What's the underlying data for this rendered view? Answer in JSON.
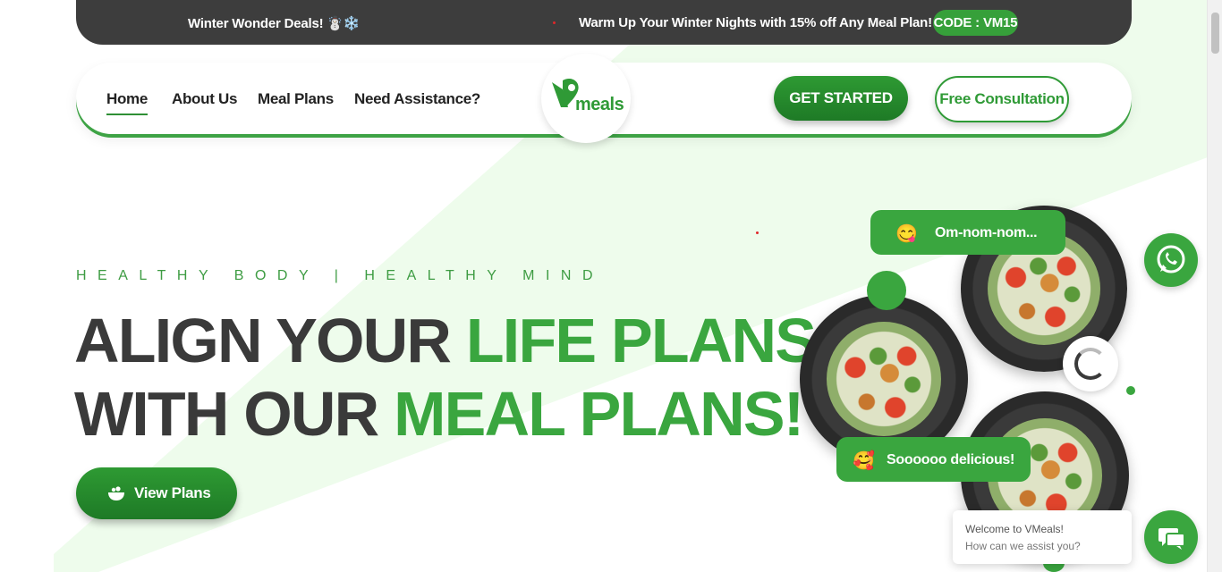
{
  "promo": {
    "left_text": "Winter Wonder Deals! ☃️❄️",
    "right_text": "Warm Up Your Winter Nights with 15% off Any Meal Plan!",
    "code": "CODE : VM15"
  },
  "nav": {
    "items": [
      {
        "label": "Home",
        "active": true
      },
      {
        "label": "About Us",
        "active": false
      },
      {
        "label": "Meal Plans",
        "active": false
      },
      {
        "label": "Need Assistance?",
        "active": false
      }
    ],
    "logo_word": "meals",
    "get_started": "GET STARTED",
    "free_consultation": "Free Consultation"
  },
  "hero": {
    "tagline": "HEALTHY BODY | HEALTHY MIND",
    "line1_dark": "ALIGN YOUR ",
    "line1_green": "LIFE PLANS",
    "line2_dark": "WITH OUR ",
    "line2_green": "MEAL PLANS!",
    "view_plans": "View Plans"
  },
  "bubbles": {
    "top": {
      "emoji": "😋",
      "text": "Om-nom-nom..."
    },
    "bottom": {
      "emoji": "🥰",
      "text": "Soooooo delicious!"
    }
  },
  "chat": {
    "welcome": "Welcome to VMeals!",
    "assist": "How can we assist you?"
  },
  "colors": {
    "brand_green": "#3aa63f",
    "dark_green": "#1e7a26",
    "promo_bg": "#3d3d3d"
  }
}
